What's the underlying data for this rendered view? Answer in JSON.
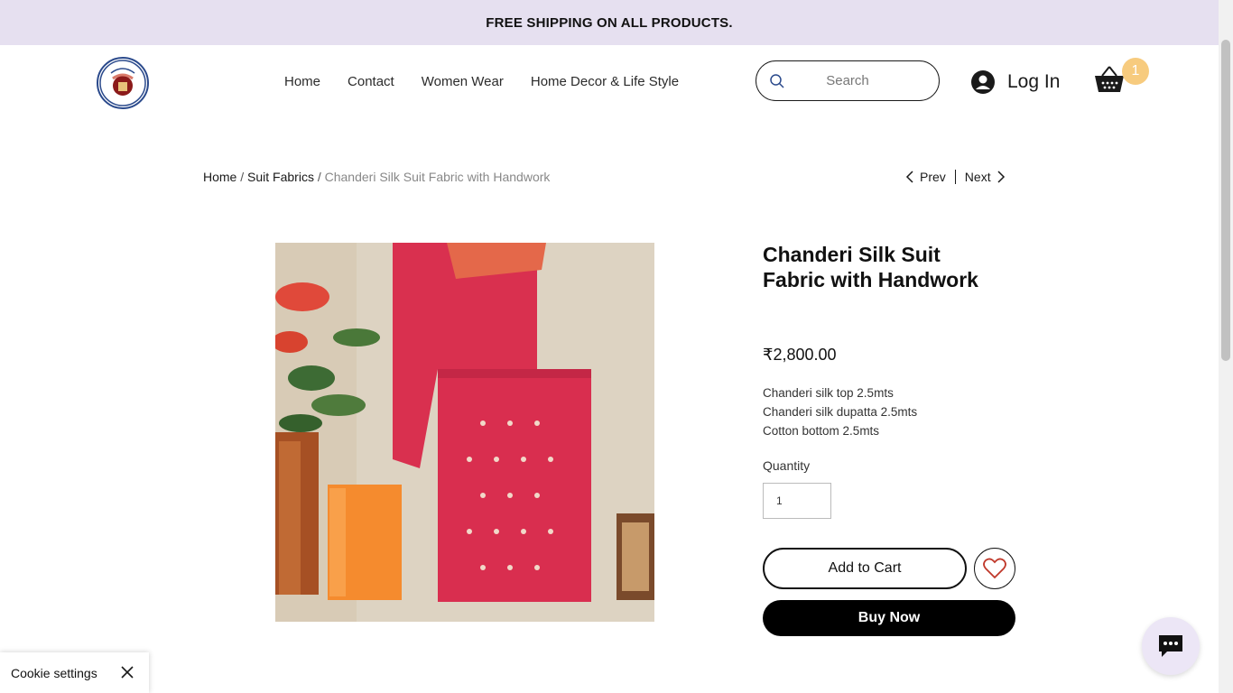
{
  "announcement": {
    "text": "FREE SHIPPING ON ALL PRODUCTS."
  },
  "brand": {
    "logo_text": "Gulabi Blocks"
  },
  "nav": {
    "items": [
      {
        "label": "Home"
      },
      {
        "label": "Contact"
      },
      {
        "label": "Women Wear"
      },
      {
        "label": "Home Decor & Life Style"
      }
    ]
  },
  "search": {
    "placeholder": "Search"
  },
  "login": {
    "label": "Log In"
  },
  "cart": {
    "count": "1"
  },
  "breadcrumb": {
    "home": "Home",
    "category": "Suit Fabrics",
    "separator": "/",
    "current": "Chanderi Silk Suit Fabric with Handwork"
  },
  "pagination": {
    "prev": "Prev",
    "next": "Next"
  },
  "product": {
    "title": "Chanderi Silk Suit Fabric with Handwork",
    "price": "₹2,800.00",
    "description": [
      "Chanderi silk top 2.5mts",
      "Chanderi silk dupatta 2.5mts",
      "Cotton bottom 2.5mts"
    ],
    "quantity_label": "Quantity",
    "quantity_value": "1",
    "add_to_cart": "Add to Cart",
    "buy_now": "Buy Now"
  },
  "cookie": {
    "label": "Cookie settings"
  },
  "colors": {
    "announcement_bg": "#e6e0f0",
    "badge": "#f7cb7e",
    "heart": "#c0392b",
    "primary_button": "#000000"
  }
}
